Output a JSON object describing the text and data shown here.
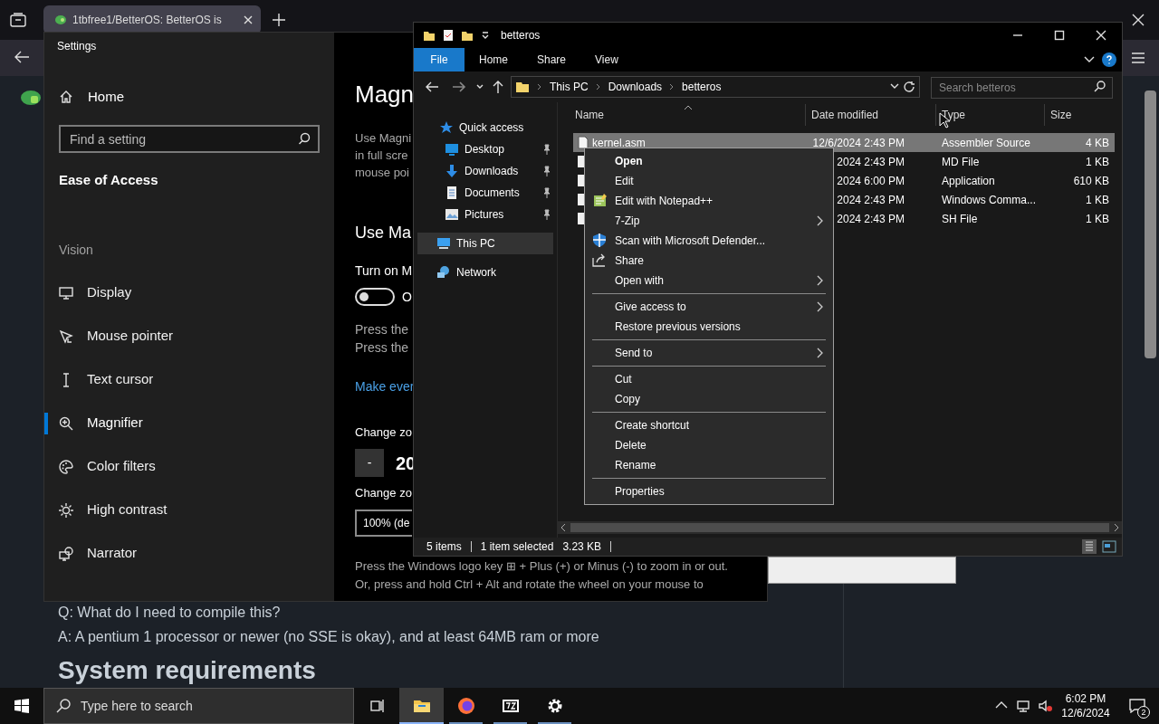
{
  "browser": {
    "tab": {
      "title": "1tbfree1/BetterOS: BetterOS is"
    },
    "page": {
      "lines": [
        {
          "kind": "paragraph",
          "text": "Q: What do I need to compile this?"
        },
        {
          "kind": "paragraph",
          "text": "A: A pentium 1 processor or newer (no SSE is okay), and at least 64MB ram or more"
        },
        {
          "kind": "heading",
          "text": "System requirements"
        }
      ]
    }
  },
  "settings": {
    "title": "Settings",
    "home": "Home",
    "search": {
      "placeholder": "Find a setting"
    },
    "category": "Ease of Access",
    "section": "Vision",
    "items": [
      {
        "label": "Display",
        "selected": false
      },
      {
        "label": "Mouse pointer",
        "selected": false
      },
      {
        "label": "Text cursor",
        "selected": false
      },
      {
        "label": "Magnifier",
        "selected": true
      },
      {
        "label": "Color filters",
        "selected": false
      },
      {
        "label": "High contrast",
        "selected": false
      },
      {
        "label": "Narrator",
        "selected": false
      }
    ],
    "content": {
      "title": "Magn",
      "description": [
        "Use Magni",
        "in full scre",
        "mouse poi"
      ],
      "heading": "Use Ma",
      "toggle": {
        "label": "Turn on M",
        "on": false,
        "state_text": "O"
      },
      "hints": [
        "Press the",
        "Press the"
      ],
      "link": "Make ever",
      "zoom_level": {
        "label": "Change zo",
        "minus": "-",
        "value": "20"
      },
      "zoom_increment": {
        "label": "Change zo",
        "value": "100% (de"
      },
      "shortcut_hint": "Press the Windows logo key ⊞ + Plus (+) or Minus (-) to zoom in or out.",
      "mouse_hint": "Or, press and hold Ctrl + Alt and rotate the wheel on your mouse to"
    }
  },
  "explorer": {
    "title": "betteros",
    "ribbon_tabs": [
      {
        "label": "File",
        "selected": true
      },
      {
        "label": "Home",
        "selected": false
      },
      {
        "label": "Share",
        "selected": false
      },
      {
        "label": "View",
        "selected": false
      }
    ],
    "path": [
      "This PC",
      "Downloads",
      "betteros"
    ],
    "search": {
      "placeholder": "Search betteros"
    },
    "nav": [
      {
        "label": "Quick access",
        "selected": false,
        "pinned": false,
        "children": [
          {
            "label": "Desktop",
            "selected": false,
            "pinned": true
          },
          {
            "label": "Downloads",
            "selected": false,
            "pinned": true
          },
          {
            "label": "Documents",
            "selected": false,
            "pinned": true
          },
          {
            "label": "Pictures",
            "selected": false,
            "pinned": true
          }
        ]
      },
      {
        "label": "This PC",
        "selected": true,
        "pinned": false
      },
      {
        "label": "Network",
        "selected": false,
        "pinned": false
      }
    ],
    "columns": [
      "Name",
      "Date modified",
      "Type",
      "Size"
    ],
    "rows": [
      {
        "name": "kernel.asm",
        "date": "12/6/2024 2:43 PM",
        "type": "Assembler Source",
        "size": "4 KB",
        "selected": true
      },
      {
        "date": "2024 2:43 PM",
        "type": "MD File",
        "size": "1 KB",
        "selected": false
      },
      {
        "date": "2024 6:00 PM",
        "type": "Application",
        "size": "610 KB",
        "selected": false
      },
      {
        "date": "2024 2:43 PM",
        "type": "Windows Comma...",
        "size": "1 KB",
        "selected": false
      },
      {
        "date": "2024 2:43 PM",
        "type": "SH File",
        "size": "1 KB",
        "selected": false
      }
    ],
    "context_menu": [
      {
        "kind": "item",
        "label": "Open",
        "default": true,
        "submenu": false
      },
      {
        "kind": "item",
        "label": "Edit",
        "default": false,
        "submenu": false
      },
      {
        "kind": "item",
        "label": "Edit with Notepad++",
        "default": false,
        "submenu": false
      },
      {
        "kind": "item",
        "label": "7-Zip",
        "default": false,
        "submenu": true
      },
      {
        "kind": "item",
        "label": "Scan with Microsoft Defender...",
        "default": false,
        "submenu": false
      },
      {
        "kind": "item",
        "label": "Share",
        "default": false,
        "submenu": false
      },
      {
        "kind": "item",
        "label": "Open with",
        "default": false,
        "submenu": true
      },
      {
        "kind": "separator"
      },
      {
        "kind": "item",
        "label": "Give access to",
        "default": false,
        "submenu": true
      },
      {
        "kind": "item",
        "label": "Restore previous versions",
        "default": false,
        "submenu": false
      },
      {
        "kind": "separator"
      },
      {
        "kind": "item",
        "label": "Send to",
        "default": false,
        "submenu": true
      },
      {
        "kind": "separator"
      },
      {
        "kind": "item",
        "label": "Cut",
        "default": false,
        "submenu": false
      },
      {
        "kind": "item",
        "label": "Copy",
        "default": false,
        "submenu": false
      },
      {
        "kind": "separator"
      },
      {
        "kind": "item",
        "label": "Create shortcut",
        "default": false,
        "submenu": false
      },
      {
        "kind": "item",
        "label": "Delete",
        "default": false,
        "submenu": false
      },
      {
        "kind": "item",
        "label": "Rename",
        "default": false,
        "submenu": false
      },
      {
        "kind": "separator"
      },
      {
        "kind": "item",
        "label": "Properties",
        "default": false,
        "submenu": false
      }
    ],
    "status": {
      "count": "5 items",
      "selection": "1 item selected",
      "size": "3.23 KB"
    }
  },
  "taskbar": {
    "search": {
      "placeholder": "Type here to search"
    },
    "apps": [
      {
        "selected": true
      },
      {
        "selected": false
      },
      {
        "selected": false
      },
      {
        "selected": false
      }
    ],
    "time": "6:02 PM",
    "date": "12/6/2024",
    "notifications": "2"
  }
}
